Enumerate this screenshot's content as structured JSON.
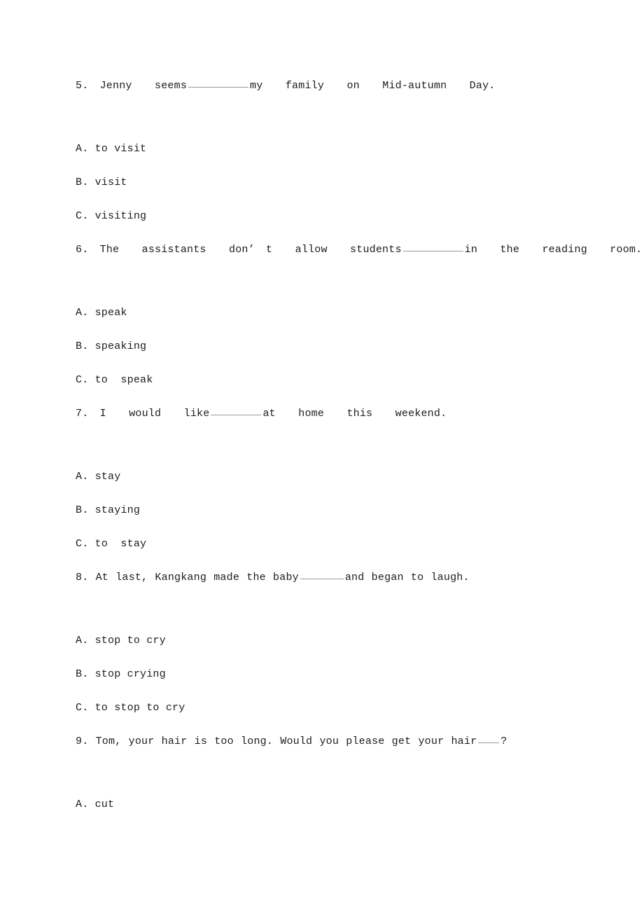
{
  "document": {
    "background_color": "#ffffff",
    "text_color": "#1c1c1c",
    "blank_color": "#9a9a9a"
  },
  "questions": [
    {
      "number": "5.",
      "stem_before": "5. Jenny  seems",
      "stem_after": "my  family  on  Mid-autumn  Day.",
      "blank_size": "blank-lg",
      "options": [
        "A. to visit",
        "B. visit",
        "C. visiting"
      ]
    },
    {
      "number": "6.",
      "stem_before": "6. The  assistants  don’ t  allow  students",
      "stem_after": "in  the  reading  room.",
      "blank_size": "blank-lg",
      "options": [
        "A. speak",
        "B. speaking",
        "C. to  speak"
      ]
    },
    {
      "number": "7.",
      "stem_before": "7. I  would  like",
      "stem_after": "at  home  this  weekend.",
      "blank_size": "blank-md",
      "options": [
        "A. stay",
        "B. staying",
        "C. to  stay"
      ]
    },
    {
      "number": "8.",
      "stem_before": "8. At last, Kangkang made the baby",
      "stem_after": "and began to laugh.",
      "blank_size": "blank-sm",
      "options": [
        "A. stop to cry",
        "B. stop crying",
        "C. to stop to cry"
      ]
    },
    {
      "number": "9.",
      "stem_before": "9. Tom, your hair is too long. Would you please get your hair",
      "stem_after": "?",
      "blank_size": "blank-xs",
      "options": [
        "A. cut"
      ]
    }
  ]
}
